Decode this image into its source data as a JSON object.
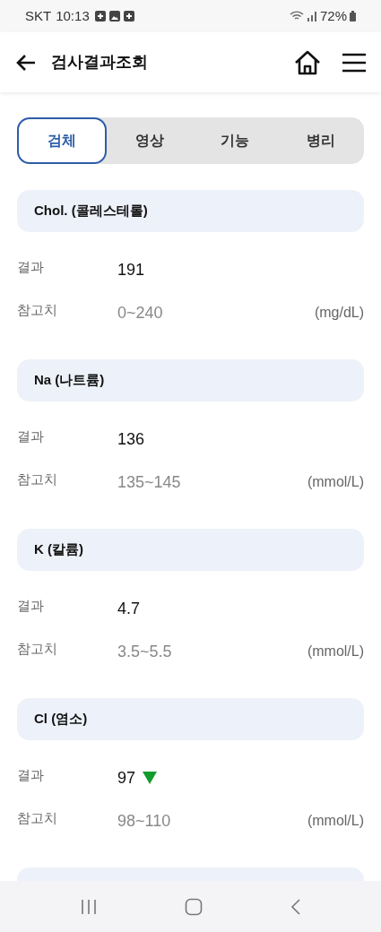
{
  "status_bar": {
    "carrier": "SKT",
    "time": "10:13",
    "battery": "72%"
  },
  "header": {
    "title": "검사결과조회"
  },
  "tabs": [
    {
      "label": "검체",
      "selected": true
    },
    {
      "label": "영상",
      "selected": false
    },
    {
      "label": "기능",
      "selected": false
    },
    {
      "label": "병리",
      "selected": false
    }
  ],
  "tests": [
    {
      "name": "Chol. (콜레스테롤)",
      "result_label": "결과",
      "result": "191",
      "low": false,
      "reference_label": "참고치",
      "range": "0~240",
      "unit": "(mg/dL)"
    },
    {
      "name": "Na (나트륨)",
      "result_label": "결과",
      "result": "136",
      "low": false,
      "reference_label": "참고치",
      "range": "135~145",
      "unit": "(mmol/L)"
    },
    {
      "name": "K (칼륨)",
      "result_label": "결과",
      "result": "4.7",
      "low": false,
      "reference_label": "참고치",
      "range": "3.5~5.5",
      "unit": "(mmol/L)"
    },
    {
      "name": "Cl (염소)",
      "result_label": "결과",
      "result": "97",
      "low": true,
      "reference_label": "참고치",
      "range": "98~110",
      "unit": "(mmol/L)"
    }
  ]
}
